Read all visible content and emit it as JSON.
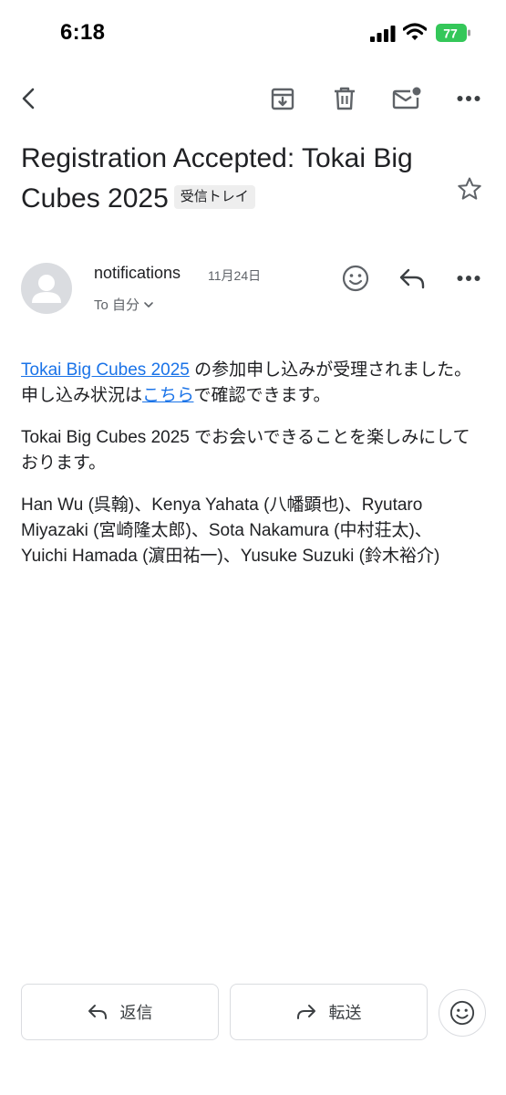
{
  "status_bar": {
    "time": "6:18",
    "battery_level": "77"
  },
  "toolbar": {
    "back_icon": "arrow-left-icon",
    "archive_icon": "archive-icon",
    "delete_icon": "trash-icon",
    "unread_icon": "mark-unread-icon",
    "more_icon": "more-horizontal-icon"
  },
  "message": {
    "subject": "Registration Accepted: Tokai Big Cubes 2025",
    "label": "受信トレイ",
    "sender": "notifications",
    "date": "11月24日",
    "recipient": "To 自分",
    "body": {
      "p1_link": "Tokai Big Cubes 2025",
      "p1_text_a": " の参加申し込みが受理されました。申し込み状況は",
      "p1_link2": "こちら",
      "p1_text_b": "で確認できます。",
      "p2": "Tokai Big Cubes 2025 でお会いできることを楽しみにしております。",
      "p3": "Han Wu (呉翰)、Kenya Yahata (八幡顕也)、Ryutaro Miyazaki (宮崎隆太郎)、Sota Nakamura (中村荘太)、Yuichi Hamada (濵田祐一)、Yusuke Suzuki (鈴木裕介)"
    }
  },
  "actions": {
    "reply": "返信",
    "forward": "転送"
  },
  "colors": {
    "link": "#1a73e8",
    "battery": "#34c759",
    "icon": "#5f6368"
  }
}
